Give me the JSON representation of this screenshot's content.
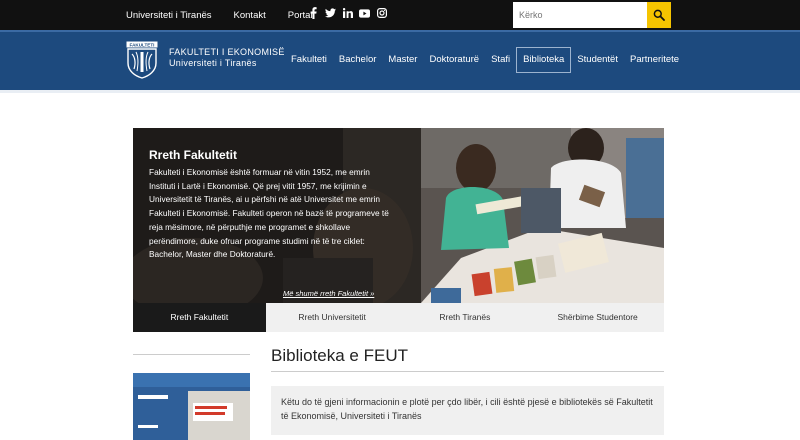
{
  "topbar": {
    "links": [
      "Universiteti i Tiranës",
      "Kontakt",
      "Portali"
    ],
    "social_icons": [
      "facebook-icon",
      "twitter-icon",
      "linkedin-icon",
      "youtube-icon",
      "instagram-icon"
    ],
    "search_placeholder": "Kërko"
  },
  "brand": {
    "logo_label": "FAKULTETI",
    "line1": "FAKULTETI I EKONOMISË",
    "line2": "Universiteti i Tiranës"
  },
  "nav": {
    "items": [
      "Fakulteti",
      "Bachelor",
      "Master",
      "Doktoraturë",
      "Stafi",
      "Biblioteka",
      "Studentët",
      "Partneritete"
    ],
    "active": "Biblioteka"
  },
  "hero": {
    "title": "Rreth Fakultetit",
    "text": "Fakulteti i Ekonomisë është formuar në vitin 1952, me emrin Instituti i Lartë i Ekonomisë. Që prej vitit 1957, me krijimin e Universitetit të Tiranës, ai u përfshi në atë Universitet me emrin Fakulteti i Ekonomisë. Fakulteti operon në bazë të programeve të reja mësimore, në përputhje me programet e shkollave perëndimore, duke ofruar programe studimi në të tre ciklet: Bachelor, Master dhe Doktoraturë.",
    "more_link": "Më shumë rreth Fakultetit »"
  },
  "tabs": [
    "Rreth Fakultetit",
    "Rreth Universitetit",
    "Rreth Tiranës",
    "Shërbime Studentore"
  ],
  "page": {
    "title": "Biblioteka e FEUT",
    "intro": "Këtu do të gjeni informacionin e plotë per çdo libër, i cili është pjesë e bibliotekës së Fakultetit të Ekonomisë, Universiteti i Tiranës"
  },
  "colors": {
    "topbar": "#111111",
    "navbar": "#1d4a7e",
    "search_button": "#f5c400",
    "active_tab": "#1a1a1a"
  }
}
